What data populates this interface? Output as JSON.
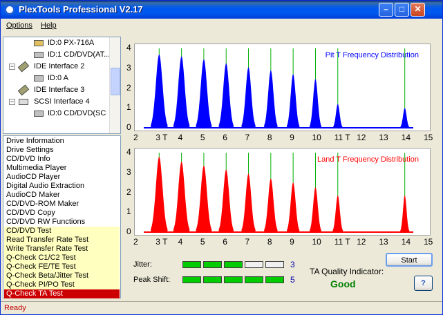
{
  "window": {
    "title": "PlexTools Professional V2.17"
  },
  "menu": {
    "options": "Options",
    "help": "Help"
  },
  "tree": {
    "items": [
      {
        "label": "ID:0  PX-716A",
        "icon": "drive-icon"
      },
      {
        "label": "ID:1  CD/DVD(AT...",
        "icon": "drive-icon"
      },
      {
        "label": "IDE Interface 2",
        "icon": "ide-icon"
      },
      {
        "label": "ID:0  A",
        "icon": "drive-icon"
      },
      {
        "label": "IDE Interface 3",
        "icon": "ide-icon"
      },
      {
        "label": "SCSI Interface 4",
        "icon": "scsi-icon"
      },
      {
        "label": "ID:0  CD/DVD(SC",
        "icon": "drive-icon"
      }
    ]
  },
  "functions": [
    {
      "label": "Drive Information",
      "style": "normal"
    },
    {
      "label": "Drive Settings",
      "style": "normal"
    },
    {
      "label": "CD/DVD Info",
      "style": "normal"
    },
    {
      "label": "Multimedia Player",
      "style": "normal"
    },
    {
      "label": "AudioCD Player",
      "style": "normal"
    },
    {
      "label": "Digital Audio Extraction",
      "style": "normal"
    },
    {
      "label": "AudioCD Maker",
      "style": "normal"
    },
    {
      "label": "CD/DVD-ROM Maker",
      "style": "normal"
    },
    {
      "label": "CD/DVD Copy",
      "style": "normal"
    },
    {
      "label": "CD/DVD RW Functions",
      "style": "normal"
    },
    {
      "label": "CD/DVD Test",
      "style": "yellow"
    },
    {
      "label": "Read Transfer Rate Test",
      "style": "yellow"
    },
    {
      "label": "Write Transfer Rate Test",
      "style": "yellow"
    },
    {
      "label": "Q-Check C1/C2 Test",
      "style": "yellow"
    },
    {
      "label": "Q-Check FE/TE Test",
      "style": "yellow"
    },
    {
      "label": "Q-Check Beta/Jitter Test",
      "style": "yellow"
    },
    {
      "label": "Q-Check PI/PO Test",
      "style": "yellow"
    },
    {
      "label": "Q-Check TA Test",
      "style": "selected"
    }
  ],
  "chart_data": [
    {
      "type": "area",
      "title": "Pit T Frequency Distribution",
      "color": "#0000ff",
      "y_ticks": [
        "4",
        "3",
        "2",
        "1",
        "0"
      ],
      "x_ticks": [
        "2",
        "3 T",
        "4",
        "5",
        "6",
        "7",
        "8",
        "9",
        "10",
        "11 T",
        "12",
        "13",
        "14",
        "15"
      ],
      "xlim": [
        2,
        15
      ],
      "ylim": [
        0,
        4
      ],
      "marker_lines": [
        3,
        4,
        5,
        6,
        7,
        8,
        9,
        10,
        11,
        14
      ],
      "peaks": [
        {
          "center": 3,
          "height": 3.7,
          "width": 0.75
        },
        {
          "center": 4,
          "height": 3.6,
          "width": 0.72
        },
        {
          "center": 5,
          "height": 3.45,
          "width": 0.7
        },
        {
          "center": 6,
          "height": 3.25,
          "width": 0.66
        },
        {
          "center": 7,
          "height": 3.05,
          "width": 0.62
        },
        {
          "center": 8,
          "height": 2.9,
          "width": 0.6
        },
        {
          "center": 9,
          "height": 2.7,
          "width": 0.56
        },
        {
          "center": 10,
          "height": 2.45,
          "width": 0.52
        },
        {
          "center": 11,
          "height": 1.2,
          "width": 0.42
        },
        {
          "center": 14,
          "height": 1.0,
          "width": 0.4
        }
      ]
    },
    {
      "type": "area",
      "title": "Land T Frequency Distribution",
      "color": "#ff0000",
      "y_ticks": [
        "4",
        "3",
        "2",
        "1",
        "0"
      ],
      "x_ticks": [
        "2",
        "3 T",
        "4",
        "5",
        "6",
        "7",
        "8",
        "9",
        "10",
        "11 T",
        "12",
        "13",
        "14",
        "15"
      ],
      "xlim": [
        2,
        15
      ],
      "ylim": [
        0,
        4
      ],
      "marker_lines": [
        3,
        4,
        5,
        6,
        7,
        8,
        9,
        10,
        11,
        14
      ],
      "peaks": [
        {
          "center": 3,
          "height": 3.8,
          "width": 0.75
        },
        {
          "center": 4,
          "height": 3.55,
          "width": 0.72
        },
        {
          "center": 5,
          "height": 3.35,
          "width": 0.7
        },
        {
          "center": 6,
          "height": 3.15,
          "width": 0.66
        },
        {
          "center": 7,
          "height": 2.95,
          "width": 0.62
        },
        {
          "center": 8,
          "height": 2.7,
          "width": 0.6
        },
        {
          "center": 9,
          "height": 2.5,
          "width": 0.56
        },
        {
          "center": 10,
          "height": 2.25,
          "width": 0.52
        },
        {
          "center": 11,
          "height": 1.85,
          "width": 0.46
        },
        {
          "center": 14,
          "height": 1.85,
          "width": 0.4
        }
      ]
    }
  ],
  "metrics": {
    "jitter_label": "Jitter:",
    "jitter_value": "3",
    "jitter_filled": 3,
    "peak_label": "Peak Shift:",
    "peak_value": "5",
    "peak_filled": 5,
    "segments_total": 5
  },
  "ta": {
    "label": "TA Quality Indicator:",
    "value": "Good"
  },
  "buttons": {
    "start": "Start",
    "help": "?"
  },
  "status": {
    "text": "Ready"
  },
  "colors": {
    "bar_on": "#00cc00",
    "bar_off": "#f0f0f0",
    "good": "#008000"
  }
}
